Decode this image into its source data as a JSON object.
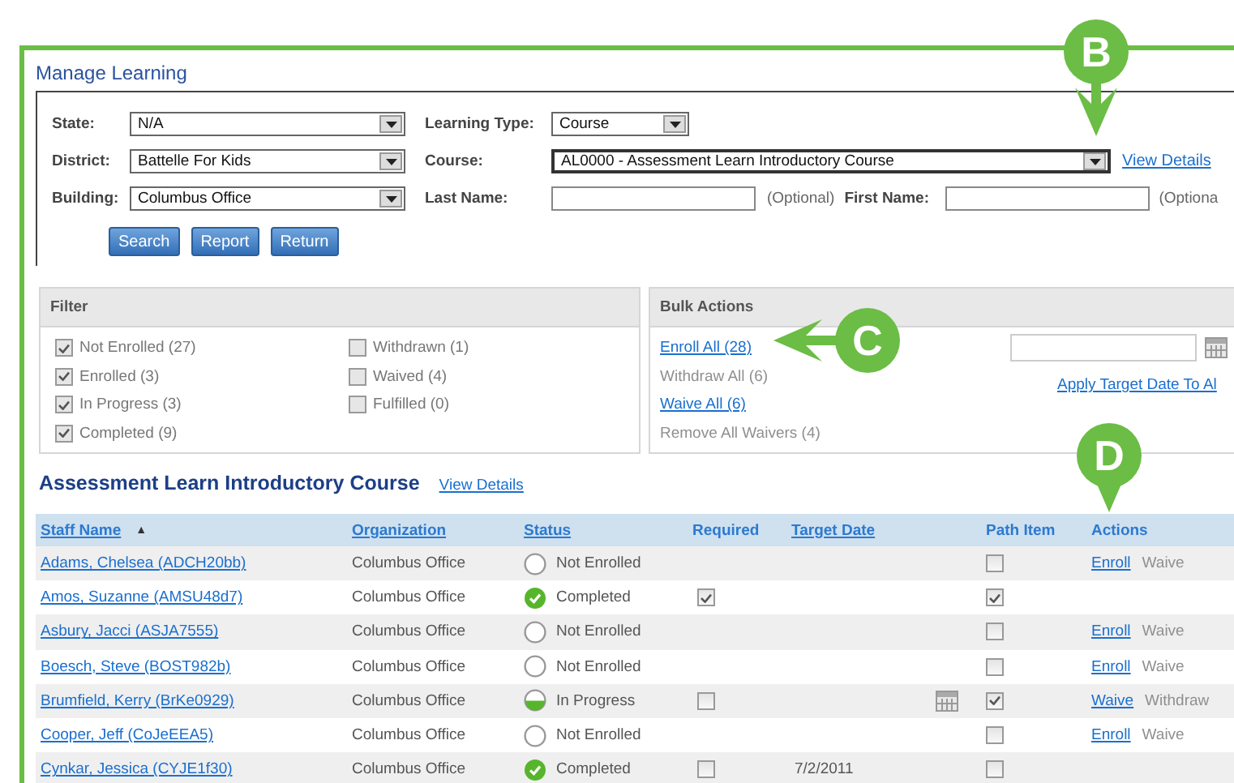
{
  "title": "Manage Learning",
  "search": {
    "state": {
      "label": "State:",
      "value": "N/A"
    },
    "district": {
      "label": "District:",
      "value": "Battelle For Kids"
    },
    "building": {
      "label": "Building:",
      "value": "Columbus Office"
    },
    "learning_type": {
      "label": "Learning Type:",
      "value": "Course"
    },
    "course": {
      "label": "Course:",
      "value": "AL0000 - Assessment Learn Introductory Course",
      "link": "View Details"
    },
    "last_name": {
      "label": "Last Name:",
      "note": "(Optional)"
    },
    "first_name": {
      "label": "First Name:",
      "note": "(Optiona"
    },
    "buttons": [
      "Search",
      "Report",
      "Return"
    ]
  },
  "filter": {
    "title": "Filter",
    "options": [
      {
        "label": "Not Enrolled (27)",
        "checked": true
      },
      {
        "label": "Enrolled (3)",
        "checked": true
      },
      {
        "label": "In Progress (3)",
        "checked": true
      },
      {
        "label": "Completed (9)",
        "checked": true
      },
      {
        "label": "Withdrawn (1)",
        "checked": false
      },
      {
        "label": "Waived (4)",
        "checked": false
      },
      {
        "label": "Fulfilled (0)",
        "checked": false
      }
    ]
  },
  "bulk": {
    "title": "Bulk Actions",
    "actions": [
      {
        "label": "Enroll All (28)",
        "disabled": false
      },
      {
        "label": "Withdraw All (6)",
        "disabled": true
      },
      {
        "label": "Waive All (6)",
        "disabled": false
      },
      {
        "label": "Remove All Waivers (4)",
        "disabled": true
      }
    ],
    "apply_link": "Apply Target Date To Al"
  },
  "course_title": "Assessment Learn Introductory Course",
  "course_link": "View Details",
  "table": {
    "columns": [
      {
        "label": "Staff Name",
        "sortable": true,
        "sort_mark": "▲"
      },
      {
        "label": "Organization",
        "sortable": true
      },
      {
        "label": "Status",
        "sortable": true
      },
      {
        "label": "Required",
        "sortable": false
      },
      {
        "label": "Target Date",
        "sortable": true
      },
      {
        "label": "Path Item",
        "sortable": false
      },
      {
        "label": "Actions",
        "sortable": false
      }
    ],
    "rows": [
      {
        "name": "Adams, Chelsea (ADCH20bb)",
        "organization": "Columbus Office",
        "kind": "not-enrolled",
        "status": "Not Enrolled",
        "path_item": false,
        "actions": [
          {
            "label": "Enroll",
            "disabled": false
          },
          {
            "label": "Waive",
            "disabled": true
          }
        ]
      },
      {
        "name": "Amos, Suzanne (AMSU48d7)",
        "organization": "Columbus Office",
        "kind": "completed",
        "status": "Completed",
        "required": true,
        "path_item": true
      },
      {
        "name": "Asbury, Jacci (ASJA7555)",
        "organization": "Columbus Office",
        "kind": "not-enrolled",
        "status": "Not Enrolled",
        "path_item": false,
        "actions": [
          {
            "label": "Enroll",
            "disabled": false
          },
          {
            "label": "Waive",
            "disabled": true
          }
        ]
      },
      {
        "name": "Boesch, Steve (BOST982b)",
        "organization": "Columbus Office",
        "kind": "not-enrolled",
        "status": "Not Enrolled",
        "path_item": false,
        "actions": [
          {
            "label": "Enroll",
            "disabled": false
          },
          {
            "label": "Waive",
            "disabled": true
          }
        ]
      },
      {
        "name": "Brumfield, Kerry (BrKe0929)",
        "organization": "Columbus Office",
        "kind": "in-progress",
        "status": "In Progress",
        "required": false,
        "date_picker": true,
        "path_item": true,
        "actions": [
          {
            "label": "Waive",
            "disabled": false
          },
          {
            "label": "Withdraw",
            "disabled": true
          }
        ]
      },
      {
        "name": "Cooper, Jeff (CoJeEEA5)",
        "organization": "Columbus Office",
        "kind": "not-enrolled",
        "status": "Not Enrolled",
        "path_item": false,
        "actions": [
          {
            "label": "Enroll",
            "disabled": false
          },
          {
            "label": "Waive",
            "disabled": true
          }
        ]
      },
      {
        "name": "Cynkar, Jessica (CYJE1f30)",
        "organization": "Columbus Office",
        "kind": "completed",
        "status": "Completed",
        "required": false,
        "target_date": "7/2/2011",
        "path_item": false
      }
    ]
  },
  "callouts": [
    {
      "letter": "B"
    },
    {
      "letter": "C"
    },
    {
      "letter": "D"
    }
  ]
}
